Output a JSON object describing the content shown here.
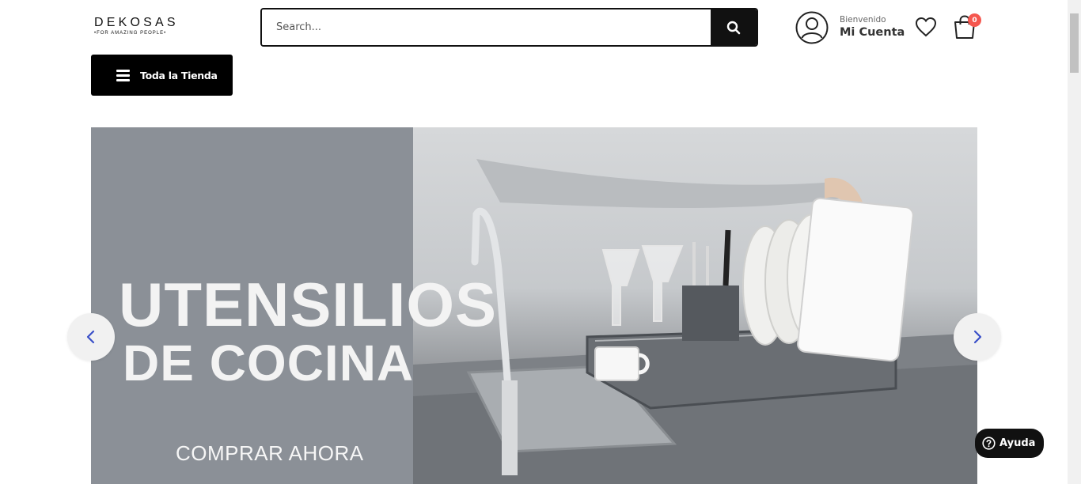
{
  "header": {
    "logo": {
      "name": "DEKOSAS",
      "tagline": "•FOR AMAZING PEOPLE•"
    },
    "search": {
      "placeholder": "Search...",
      "icon": "search-icon"
    },
    "account": {
      "welcome": "Bienvenido",
      "title": "Mi Cuenta",
      "icon": "user-circle-icon"
    },
    "wishlist": {
      "icon": "heart-icon"
    },
    "cart": {
      "icon": "shopping-bag-icon",
      "count": "0"
    }
  },
  "nav": {
    "store_button": {
      "label": "Toda la Tienda",
      "icon": "hamburger-icon"
    }
  },
  "hero": {
    "title_line1": "UTENSILIOS",
    "title_line2": "DE COCINA",
    "cta": "COMPRAR AHORA",
    "prev_icon": "chevron-left-icon",
    "next_icon": "chevron-right-icon"
  },
  "help": {
    "label": "Ayuda",
    "icon": "question-circle-icon"
  },
  "colors": {
    "primary": "#000000",
    "badge": "#f5574f",
    "arrow": "#3a4fc8",
    "banner_left": "#8b9097"
  }
}
